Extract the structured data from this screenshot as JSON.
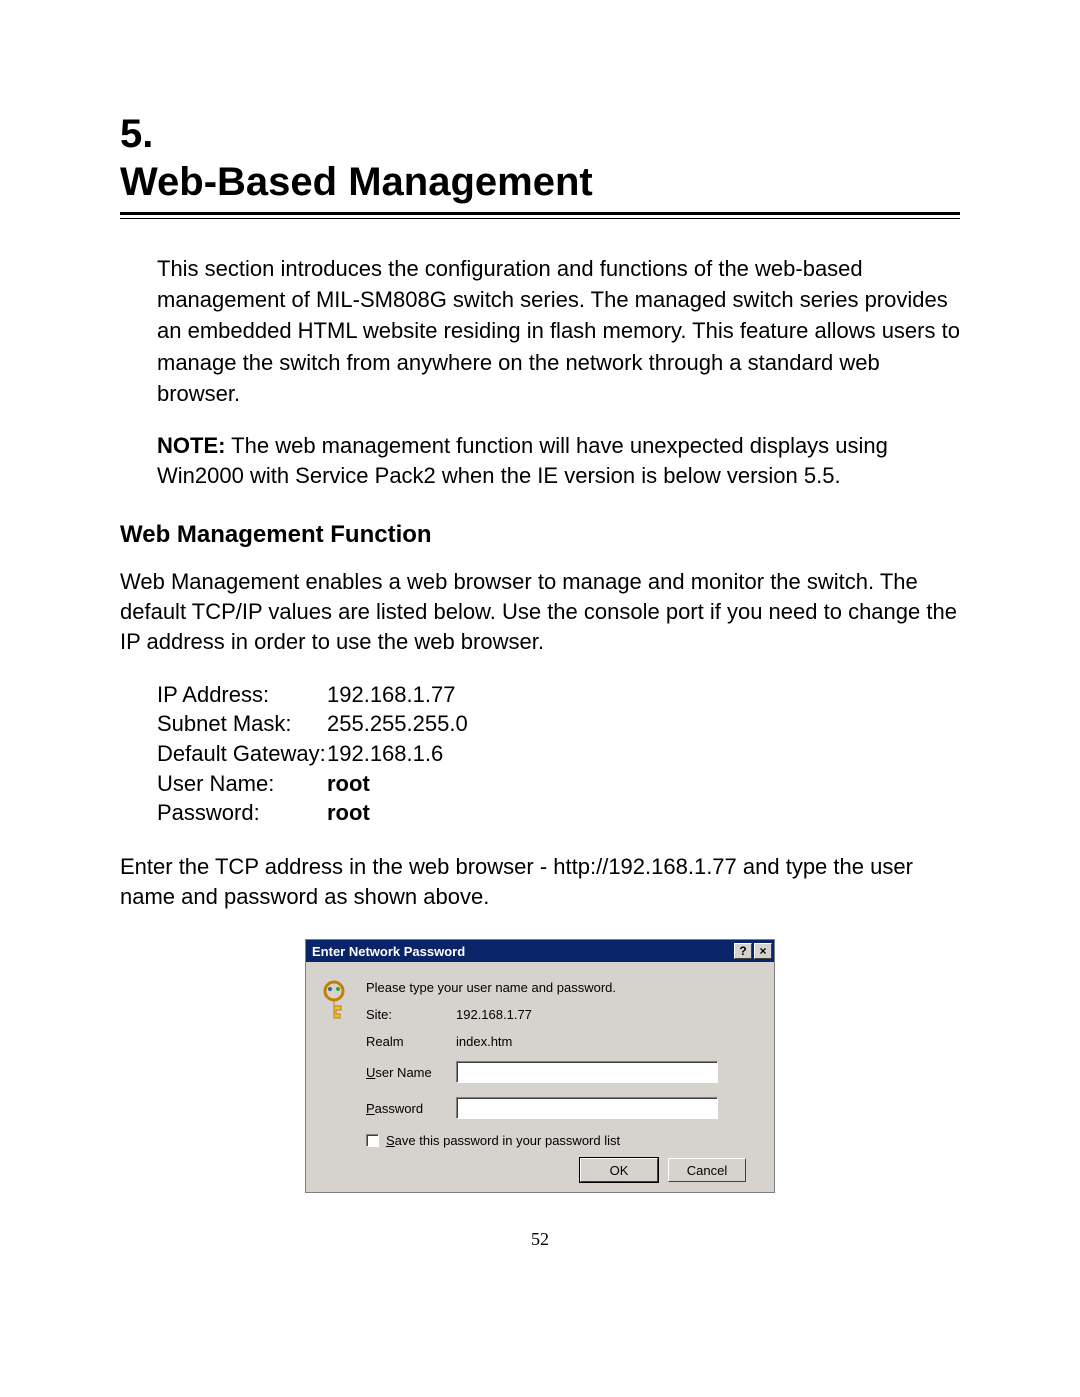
{
  "chapter": {
    "number": "5.",
    "title": "Web-Based Management"
  },
  "intro": "This section introduces the configuration and functions of the web-based management of MIL-SM808G switch series. The managed switch series provides an embedded HTML website residing in flash memory. This feature allows users to manage the switch from anywhere on the network through a standard web browser.",
  "note": {
    "label": "NOTE:",
    "text": " The web management function will have unexpected displays using Win2000 with Service Pack2 when the IE version is below version 5.5."
  },
  "section_title": "Web Management Function",
  "section_p": "Web Management enables a web browser to manage and monitor the switch. The default TCP/IP values are listed below. Use the console port if you need to change the IP address in order to use the web browser.",
  "defaults": {
    "ip_label": "IP Address:",
    "ip_val": "192.168.1.77",
    "mask_label": "Subnet Mask:",
    "mask_val": "255.255.255.0",
    "gw_label": "Default Gateway:",
    "gw_val": "192.168.1.6",
    "user_label": "User Name:",
    "user_val": "root",
    "pass_label": "Password:",
    "pass_val": "root"
  },
  "after_kv": "Enter the TCP address in the web browser - http://192.168.1.77 and type the user name and password as shown above.",
  "dialog": {
    "title": "Enter Network Password",
    "help": "?",
    "close": "×",
    "prompt": "Please type your user name and password.",
    "site_label": "Site:",
    "site_val": "192.168.1.77",
    "realm_label": "Realm",
    "realm_val": "index.htm",
    "user_label_pre": "U",
    "user_label_rest": "ser Name",
    "pass_label_pre": "P",
    "pass_label_rest": "assword",
    "user_value": "",
    "pass_value": "",
    "save_pre": "S",
    "save_rest": "ave this password in your password list",
    "ok": "OK",
    "cancel": "Cancel"
  },
  "page_number": "52"
}
